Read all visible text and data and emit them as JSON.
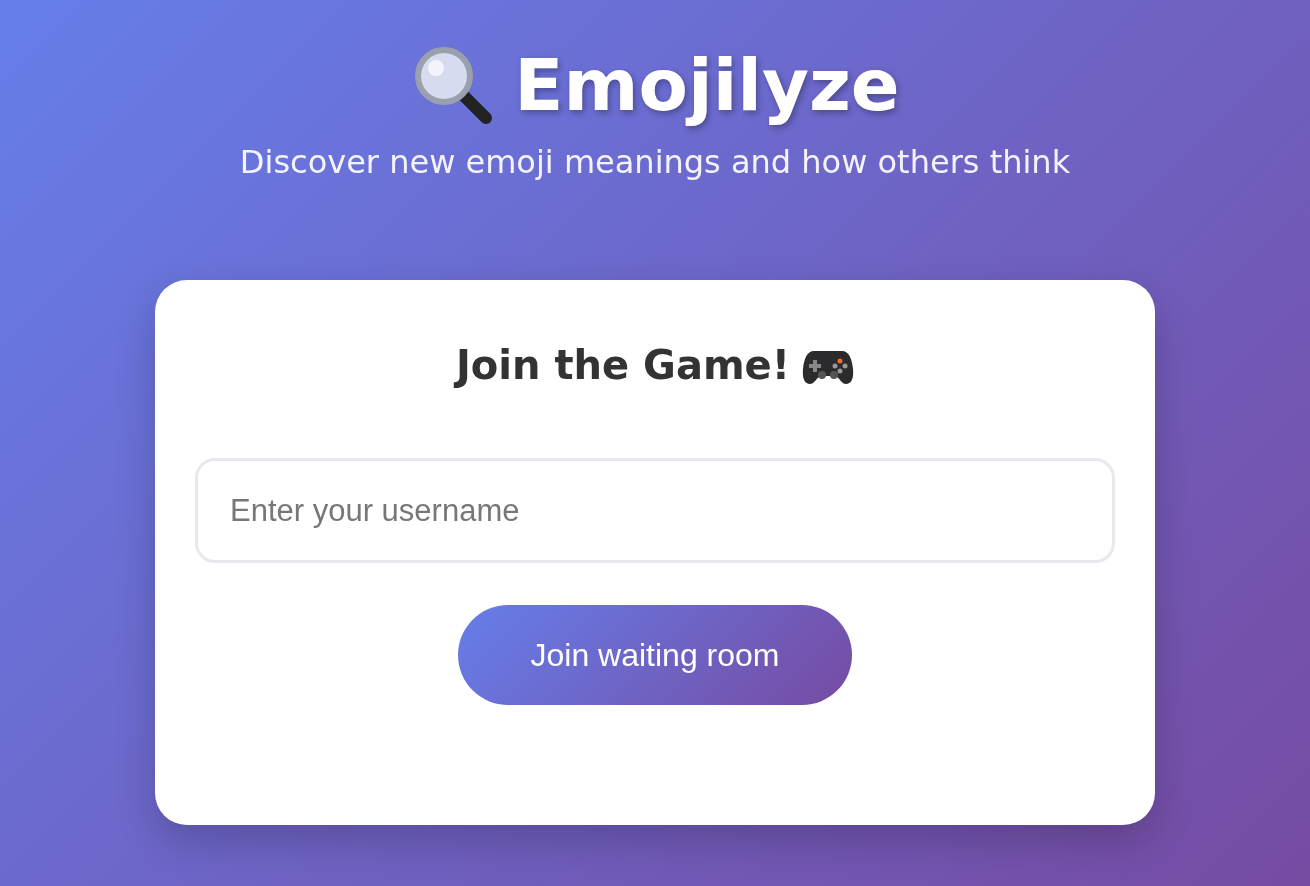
{
  "header": {
    "title": "Emojilyze",
    "subtitle": "Discover new emoji meanings and how others think"
  },
  "card": {
    "heading": "Join the Game!",
    "username_field": {
      "placeholder": "Enter your username"
    },
    "button": "Join waiting room"
  }
}
